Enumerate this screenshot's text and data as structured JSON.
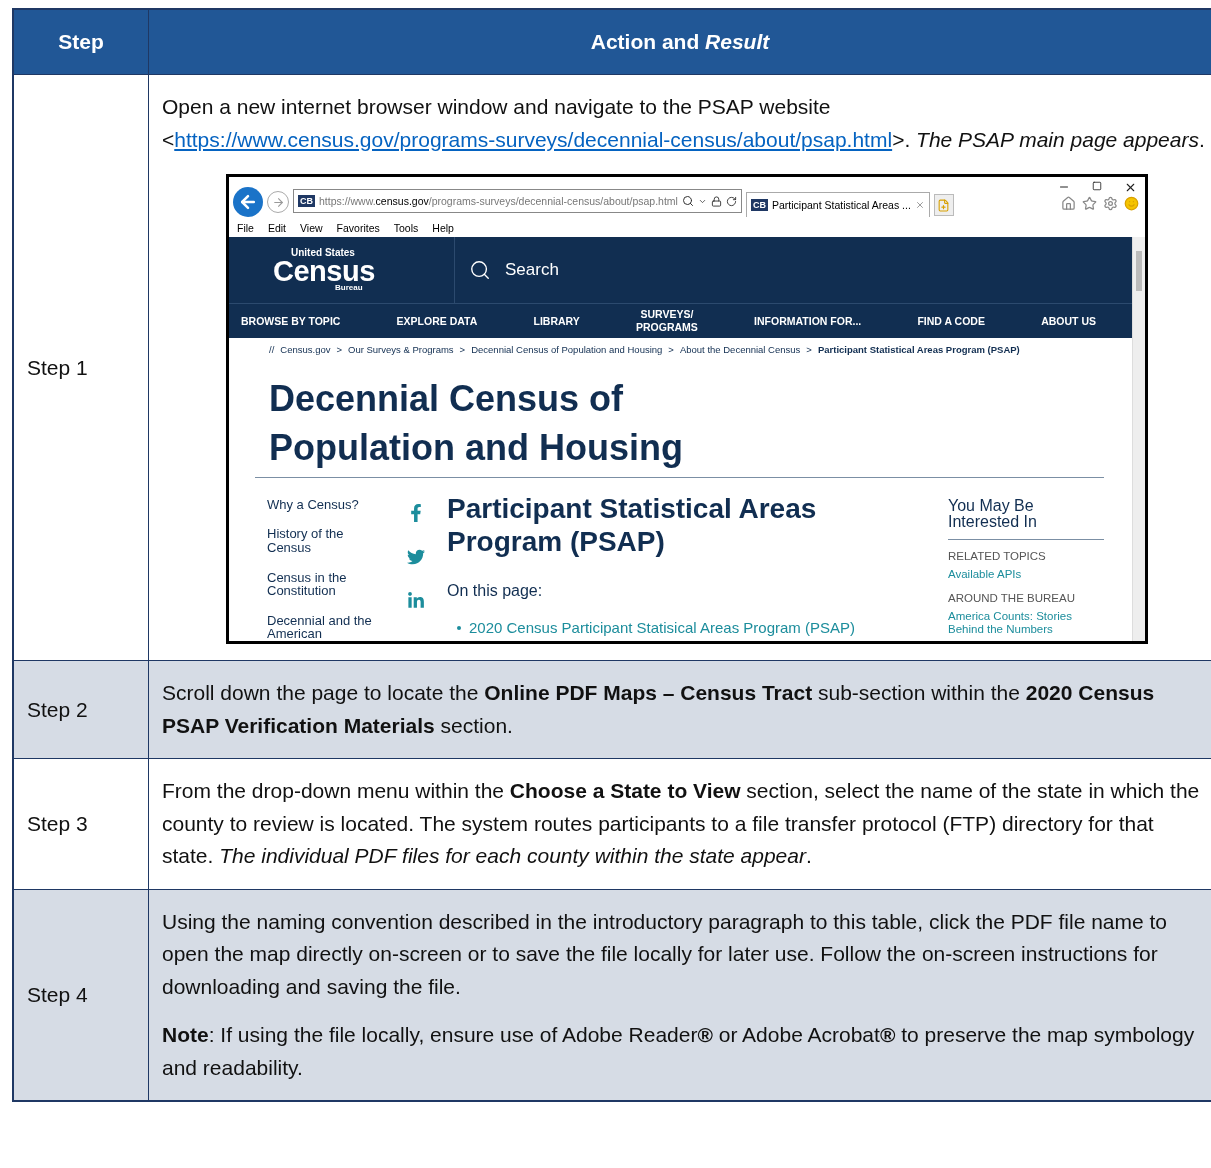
{
  "table": {
    "columns": [
      {
        "text": "Step"
      },
      {
        "text": "Action and *Result*"
      }
    ],
    "rows": [
      {
        "step": "Step 1",
        "shaded": false,
        "intro": {
          "before": "Open a new internet browser window and navigate to the PSAP website <",
          "link": "https://www.census.gov/programs-surveys/decennial-census/about/psap.html",
          "after": ">. *The PSAP main page appears*."
        },
        "screenshot": {
          "address": {
            "scheme": "https://www.",
            "domain": "census.gov",
            "path": "/programs-surveys/decennial-census/about/psap.html"
          },
          "address_favicon": "CB",
          "tab_favicon": "CB",
          "tab_title": "Participant Statistical Areas ...",
          "menu": [
            "File",
            "Edit",
            "View",
            "Favorites",
            "Tools",
            "Help"
          ],
          "logo": {
            "top": "United States",
            "main": "Census",
            "bottom": "Bureau"
          },
          "search": "Search",
          "nav": [
            "BROWSE BY TOPIC",
            "EXPLORE DATA",
            "LIBRARY",
            "SURVEYS/\nPROGRAMS",
            "INFORMATION FOR...",
            "FIND A CODE",
            "ABOUT US"
          ],
          "breadcrumb": [
            {
              "text": "Census.gov",
              "current": false
            },
            {
              "text": "Our Surveys & Programs",
              "current": false
            },
            {
              "text": "Decennial Census of Population and Housing",
              "current": false
            },
            {
              "text": "About the Decennial Census",
              "current": false
            },
            {
              "text": "Participant Statistical Areas Program (PSAP)",
              "current": true
            }
          ],
          "breadcrumb_mark": "//",
          "breadcrumb_separator": ">",
          "page_title": "Decennial Census of Population and Housing",
          "side_nav": [
            "Why a Census?",
            "History of the Census",
            "Census in the Constitution",
            "Decennial and the American"
          ],
          "heading": "Participant Statistical Areas Program (PSAP)",
          "on_this_page": "On this page:",
          "page_links": [
            "2020 Census Participant Statisical Areas Program (PSAP)"
          ],
          "aside": {
            "title": "You May Be Interested In",
            "groups": [
              {
                "label": "RELATED TOPICS",
                "links": [
                  "Available APIs"
                ]
              },
              {
                "label": "AROUND THE BUREAU",
                "links": [
                  "America Counts: Stories Behind the Numbers"
                ]
              }
            ]
          }
        }
      },
      {
        "step": "Step 2",
        "shaded": true,
        "paragraphs": [
          "Scroll down the page to locate the **Online PDF Maps – Census Tract** sub-section within the **2020 Census PSAP Verification Materials** section."
        ]
      },
      {
        "step": "Step 3",
        "shaded": false,
        "paragraphs": [
          "From the drop-down menu within the **Choose a State to View** section, select the name of the state in which the county to review is located. The system routes participants to a file transfer protocol (FTP) directory for that state. *The individual PDF files for each county within the state appear*."
        ]
      },
      {
        "step": "Step 4",
        "shaded": true,
        "paragraphs": [
          "Using the naming convention described in the introductory paragraph to this table, click the PDF file name to open the map directly on-screen or to save the file locally for later use. Follow the on-screen instructions for downloading and saving the file.",
          "**Note**: If using the file locally, ensure use of Adobe Reader**®** or Adobe Acrobat**®** to preserve the map symbology and readability."
        ]
      }
    ]
  }
}
